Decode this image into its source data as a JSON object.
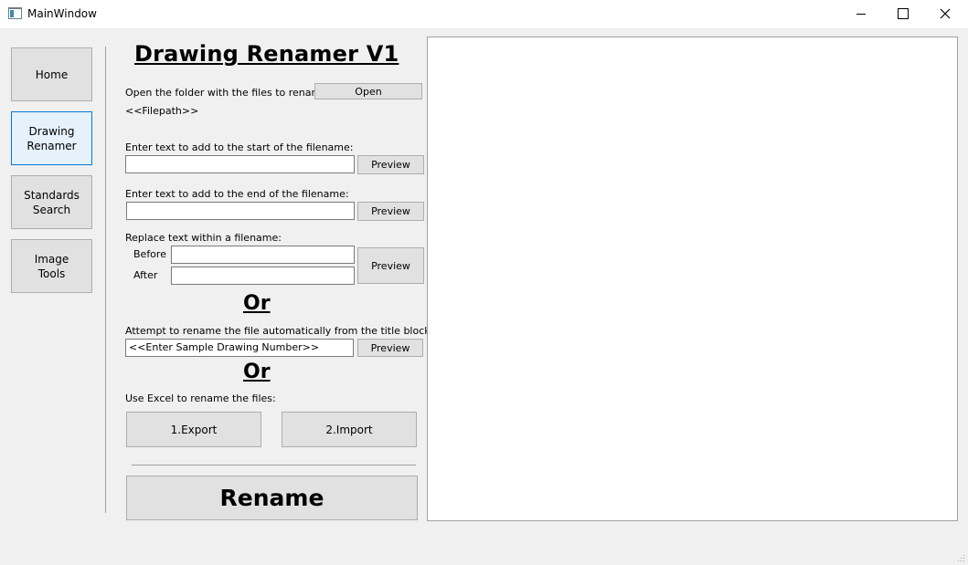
{
  "window": {
    "title": "MainWindow"
  },
  "sidebar": {
    "items": [
      {
        "label": "Home"
      },
      {
        "label": "Drawing\nRenamer"
      },
      {
        "label": "Standards\nSearch"
      },
      {
        "label": "Image\nTools"
      }
    ]
  },
  "main": {
    "heading": "Drawing Renamer V1",
    "open_prompt": "Open the folder with the files to rename:",
    "open_button": "Open",
    "filepath": "<<Filepath>>",
    "prefix_label": "Enter text to add to the start of the filename:",
    "prefix_value": "",
    "suffix_label": "Enter text to add to the end of the filename:",
    "suffix_value": "",
    "replace_label": "Replace text within a filename:",
    "before_label": "Before",
    "before_value": "",
    "after_label": "After",
    "after_value": "",
    "preview_label": "Preview",
    "or_label": "Or",
    "titleblock_label": "Attempt to rename the file automatically from the title block:",
    "titleblock_value": "<<Enter Sample Drawing Number>>",
    "excel_label": "Use Excel to rename the files:",
    "export_button": "1.Export",
    "import_button": "2.Import",
    "rename_button": "Rename"
  }
}
